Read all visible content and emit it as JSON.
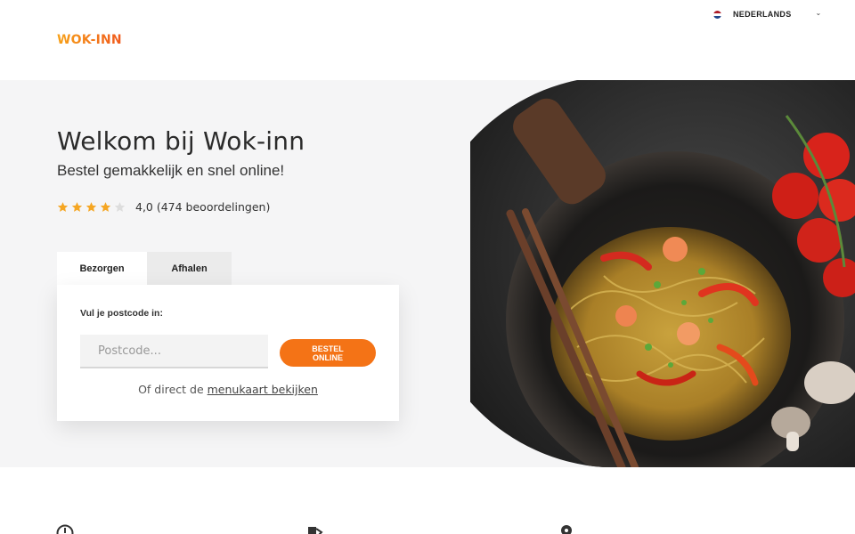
{
  "header": {
    "logo": "WOK-INN",
    "language": "NEDERLANDS"
  },
  "hero": {
    "title": "Welkom bij Wok-inn",
    "subtitle": "Bestel gemakkelijk en snel online!",
    "rating": {
      "stars_filled": 4,
      "stars_total": 5,
      "text": "4,0 (474 beoordelingen)"
    }
  },
  "tabs": [
    {
      "label": "Bezorgen",
      "active": true
    },
    {
      "label": "Afhalen",
      "active": false
    }
  ],
  "order_card": {
    "label": "Vul je postcode in:",
    "postcode_placeholder": "Postcode...",
    "postcode_value": "",
    "button_label_line1": "BESTEL",
    "button_label_line2": "ONLINE",
    "footer_prefix": "Of direct de ",
    "menu_link": "menukaart bekijken"
  },
  "colors": {
    "accent": "#f47316",
    "hero_bg": "#f5f5f6",
    "star_filled": "#f5a623",
    "star_empty": "#dddddd"
  },
  "icons": [
    "flag-nl-icon",
    "chevron-down-icon",
    "star-icon",
    "clock-icon",
    "payment-icon",
    "location-pin-icon"
  ]
}
